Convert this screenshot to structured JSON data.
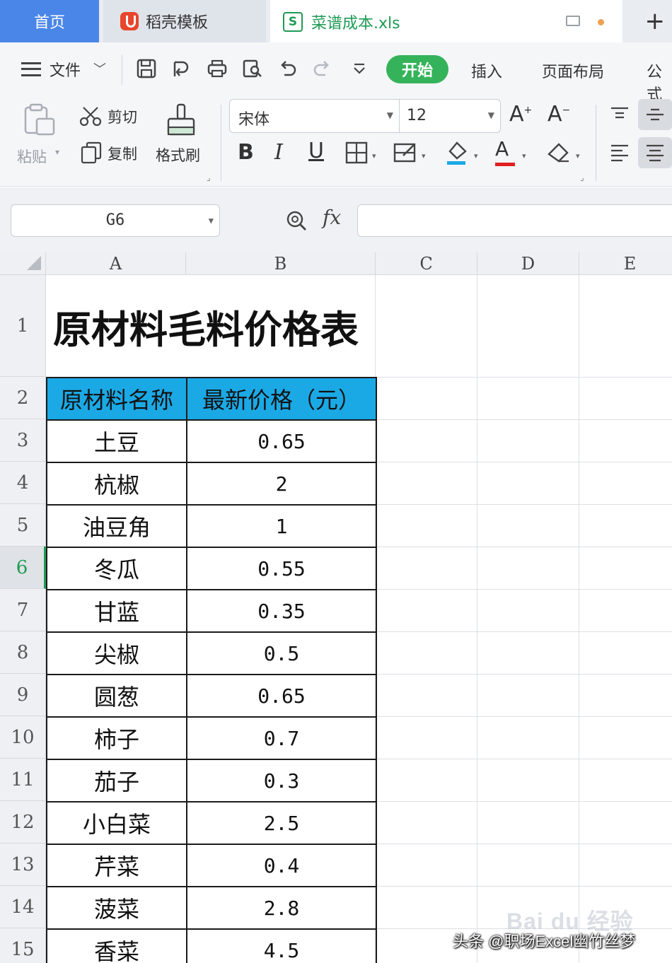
{
  "tabs": {
    "home": "首页",
    "docer": "稻壳模板",
    "file": "菜谱成本.xls",
    "file_icon": "S",
    "add": "+"
  },
  "menu": {
    "file": "文件",
    "start": "开始",
    "insert": "插入",
    "page_layout": "页面布局",
    "formula_partial": "公式"
  },
  "ribbon": {
    "paste": "粘贴",
    "cut": "剪切",
    "copy": "复制",
    "format_painter": "格式刷",
    "font_name": "宋体",
    "font_size": "12",
    "bold": "B",
    "italic": "I",
    "underline": "U",
    "font_color_letter": "A"
  },
  "formula_bar": {
    "cell_ref": "G6",
    "fx": "fx",
    "formula": ""
  },
  "sheet": {
    "columns": [
      "A",
      "B",
      "C",
      "D",
      "E"
    ],
    "rows": [
      "1",
      "2",
      "3",
      "4",
      "5",
      "6",
      "7",
      "8",
      "9",
      "10",
      "11",
      "12",
      "13",
      "14",
      "15"
    ],
    "active_row": "6",
    "title": "原材料毛料价格表",
    "header": [
      "原材料名称",
      "最新价格（元）"
    ],
    "data": [
      [
        "土豆",
        "0.65"
      ],
      [
        "杭椒",
        "2"
      ],
      [
        "油豆角",
        "1"
      ],
      [
        "冬瓜",
        "0.55"
      ],
      [
        "甘蓝",
        "0.35"
      ],
      [
        "尖椒",
        "0.5"
      ],
      [
        "圆葱",
        "0.65"
      ],
      [
        "柿子",
        "0.7"
      ],
      [
        "茄子",
        "0.3"
      ],
      [
        "小白菜",
        "2.5"
      ],
      [
        "芹菜",
        "0.4"
      ],
      [
        "菠菜",
        "2.8"
      ],
      [
        "香菜",
        "4.5"
      ]
    ]
  },
  "colors": {
    "accent_green": "#35b35a",
    "home_tab_blue": "#4a86e8",
    "header_fill": "#1ba9e6"
  },
  "overlays": {
    "watermark": "Bai du 经验",
    "source": "头条 @职场Excel幽竹丝梦"
  }
}
